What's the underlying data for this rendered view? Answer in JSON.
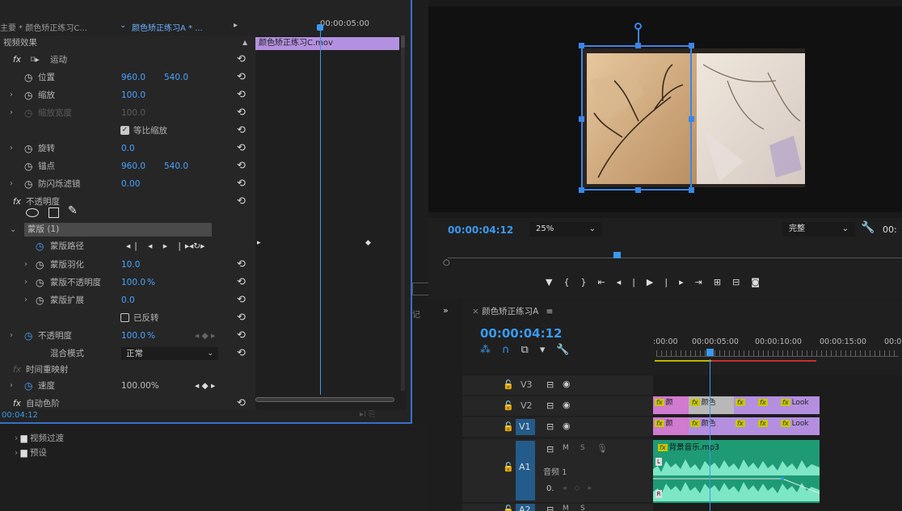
{
  "effect_controls": {
    "tabs": [
      "主要 * 颜色矫正练习C...",
      "颜色矫正练习A * ..."
    ],
    "section_title": "视频效果",
    "timeline_time": "00:00:05:00",
    "clip_name": "颜色矫正练习C.mov",
    "motion": "运动",
    "position": {
      "label": "位置",
      "x": "960.0",
      "y": "540.0"
    },
    "scale": {
      "label": "缩放",
      "value": "100.0"
    },
    "scale_width": {
      "label": "缩放宽度",
      "value": "100.0"
    },
    "uniform_scale": "等比缩放",
    "rotation": {
      "label": "旋转",
      "value": "0.0"
    },
    "anchor": {
      "label": "锚点",
      "x": "960.0",
      "y": "540.0"
    },
    "flicker": {
      "label": "防闪烁滤镜",
      "value": "0.00"
    },
    "opacity_section": "不透明度",
    "mask": "蒙版 (1)",
    "mask_path": "蒙版路径",
    "mask_feather": {
      "label": "蒙版羽化",
      "value": "10.0"
    },
    "mask_opacity": {
      "label": "蒙版不透明度",
      "value": "100.0",
      "unit": "%"
    },
    "mask_expansion": {
      "label": "蒙版扩展",
      "value": "0.0"
    },
    "inverted": "已反转",
    "opacity": {
      "label": "不透明度",
      "value": "100.0",
      "unit": "%"
    },
    "blend": {
      "label": "混合模式",
      "value": "正常"
    },
    "time_remap": "时间重映射",
    "speed": {
      "label": "速度",
      "value": "100.00%"
    },
    "auto_levels": "自动色阶",
    "current_time": "00:04:12"
  },
  "project": {
    "items": [
      "视频过渡",
      "预设"
    ],
    "tab_fragment": "记"
  },
  "program": {
    "timecode": "00:00:04:12",
    "zoom": "25%",
    "quality": "完整",
    "duration_fragment": "00:"
  },
  "timeline": {
    "title": "颜色矫正练习A",
    "timecode": "00:00:04:12",
    "ruler": [
      ":00:00",
      "00:00:05:00",
      "00:00:10:00",
      "00:00:15:00",
      "00:0"
    ],
    "tracks": {
      "v3": "V3",
      "v2": "V2",
      "v1": "V1",
      "a1": "A1",
      "a2": "A2",
      "audio_name": "音频 1",
      "m": "M",
      "s": "S",
      "vol": "0."
    },
    "audio_clip": "背景音乐.mp3",
    "v2_clips": [
      "颜",
      "颜色",
      "Look"
    ],
    "v1_clips": [
      "颜",
      "颜色",
      "Look"
    ],
    "channel_l": "L",
    "channel_r": "R"
  },
  "colors": {
    "accent": "#3a9af0",
    "mask_bar": "#b490e0",
    "audio": "#1e9a75",
    "video_clip": "#b48fe0",
    "video_clip_pink": "#d07ad0"
  }
}
